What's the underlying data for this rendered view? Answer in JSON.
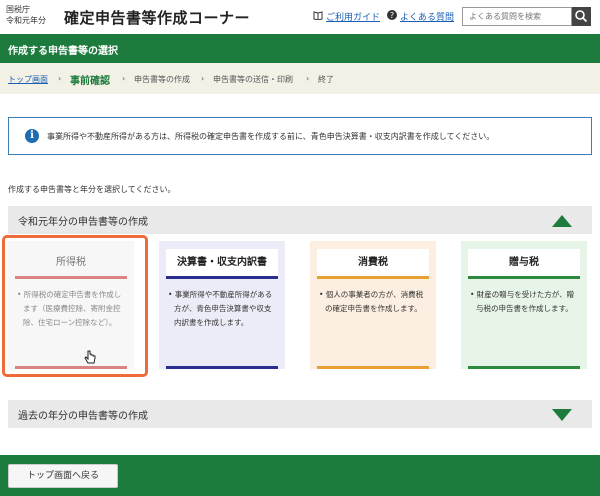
{
  "header": {
    "agency_line1": "国税庁",
    "agency_line2": "令和元年分",
    "title": "確定申告書等作成コーナー",
    "guide_link": "ご利用ガイド",
    "faq_link": "よくある質問",
    "search_placeholder": "よくある質問を検索"
  },
  "section_bar": {
    "title": "作成する申告書等の選択"
  },
  "breadcrumb": {
    "home": "トップ画面",
    "current": "事前確認",
    "step3": "申告書等の作成",
    "step4": "申告書等の送信・印刷",
    "step5": "終了"
  },
  "info": {
    "text": "事業所得や不動産所得がある方は、所得税の確定申告書を作成する前に、青色申告決算書・収支内訳書を作成してください。"
  },
  "prompt": "作成する申告書等と年分を選択してください。",
  "accordion_current": {
    "title": "令和元年分の申告書等の作成"
  },
  "cards": [
    {
      "title": "所得税",
      "desc": "• 所得税の確定申告書を作成します（医療費控除、寄附金控除、住宅ローン控除など）。",
      "accent": "#d98383"
    },
    {
      "title": "決算書・収支内訳書",
      "desc": "• 事業所得や不動産所得がある方が、青色申告決算書や収支内訳書を作成します。",
      "accent": "#2b2c8f"
    },
    {
      "title": "消費税",
      "desc": "• 個人の事業者の方が、消費税の確定申告書を作成します。",
      "accent": "#e8a032"
    },
    {
      "title": "贈与税",
      "desc": "• 財産の贈与を受けた方が、贈与税の申告書を作成します。",
      "accent": "#2b8a3e"
    }
  ],
  "accordion_past": {
    "title": "過去の年分の申告書等の作成"
  },
  "footer": {
    "back_label": "トップ画面へ戻る"
  },
  "colors": {
    "primary_green": "#1c7b3d",
    "selection_orange": "#ef6b3a",
    "link_blue": "#1a5fb4"
  }
}
